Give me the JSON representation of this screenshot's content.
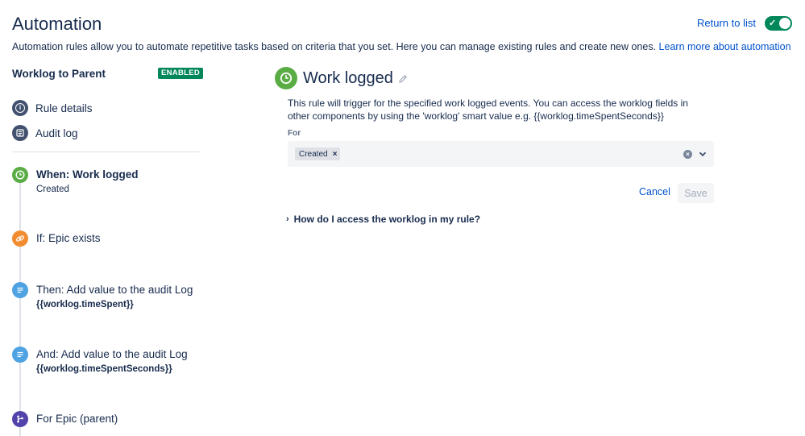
{
  "header": {
    "title": "Automation",
    "return_link": "Return to list",
    "toggle_on": true,
    "description": "Automation rules allow you to automate repetitive tasks based on criteria that you set. Here you can manage existing rules and create new ones.",
    "learn_more": "Learn more about automation"
  },
  "sidebar": {
    "rule_name": "Worklog to Parent",
    "status_badge": "ENABLED",
    "nav": [
      {
        "label": "Rule details",
        "icon": "info-icon"
      },
      {
        "label": "Audit log",
        "icon": "list-icon"
      }
    ],
    "steps": [
      {
        "title": "When: Work logged",
        "sub": "Created",
        "icon": "clock-icon",
        "color": "#5aac44"
      },
      {
        "title": "If: Epic exists",
        "sub": "",
        "icon": "link-icon",
        "color": "#f18d30"
      },
      {
        "title": "Then: Add value to the audit Log",
        "sub": "{{worklog.timeSpent}}",
        "icon": "audit-log-icon",
        "color": "#4fa3e3"
      },
      {
        "title": "And: Add value to the audit Log",
        "sub": "{{worklog.timeSpentSeconds}}",
        "icon": "audit-log-icon",
        "color": "#4fa3e3"
      },
      {
        "title": "For Epic (parent)",
        "sub": "",
        "icon": "branch-icon",
        "color": "#5243aa"
      }
    ]
  },
  "panel": {
    "title": "Work logged",
    "description": "This rule will trigger for the specified work logged events. You can access the worklog fields in other components by using the 'worklog' smart value e.g. {{worklog.timeSpentSeconds}}",
    "for_label": "For",
    "selected_tag": "Created",
    "cancel_label": "Cancel",
    "save_label": "Save",
    "faq": "How do I access the worklog in my rule?"
  },
  "colors": {
    "accent": "#0052cc",
    "enabled": "#00875a",
    "trigger": "#5aac44",
    "condition": "#f18d30",
    "action": "#4fa3e3",
    "branch": "#5243aa"
  }
}
